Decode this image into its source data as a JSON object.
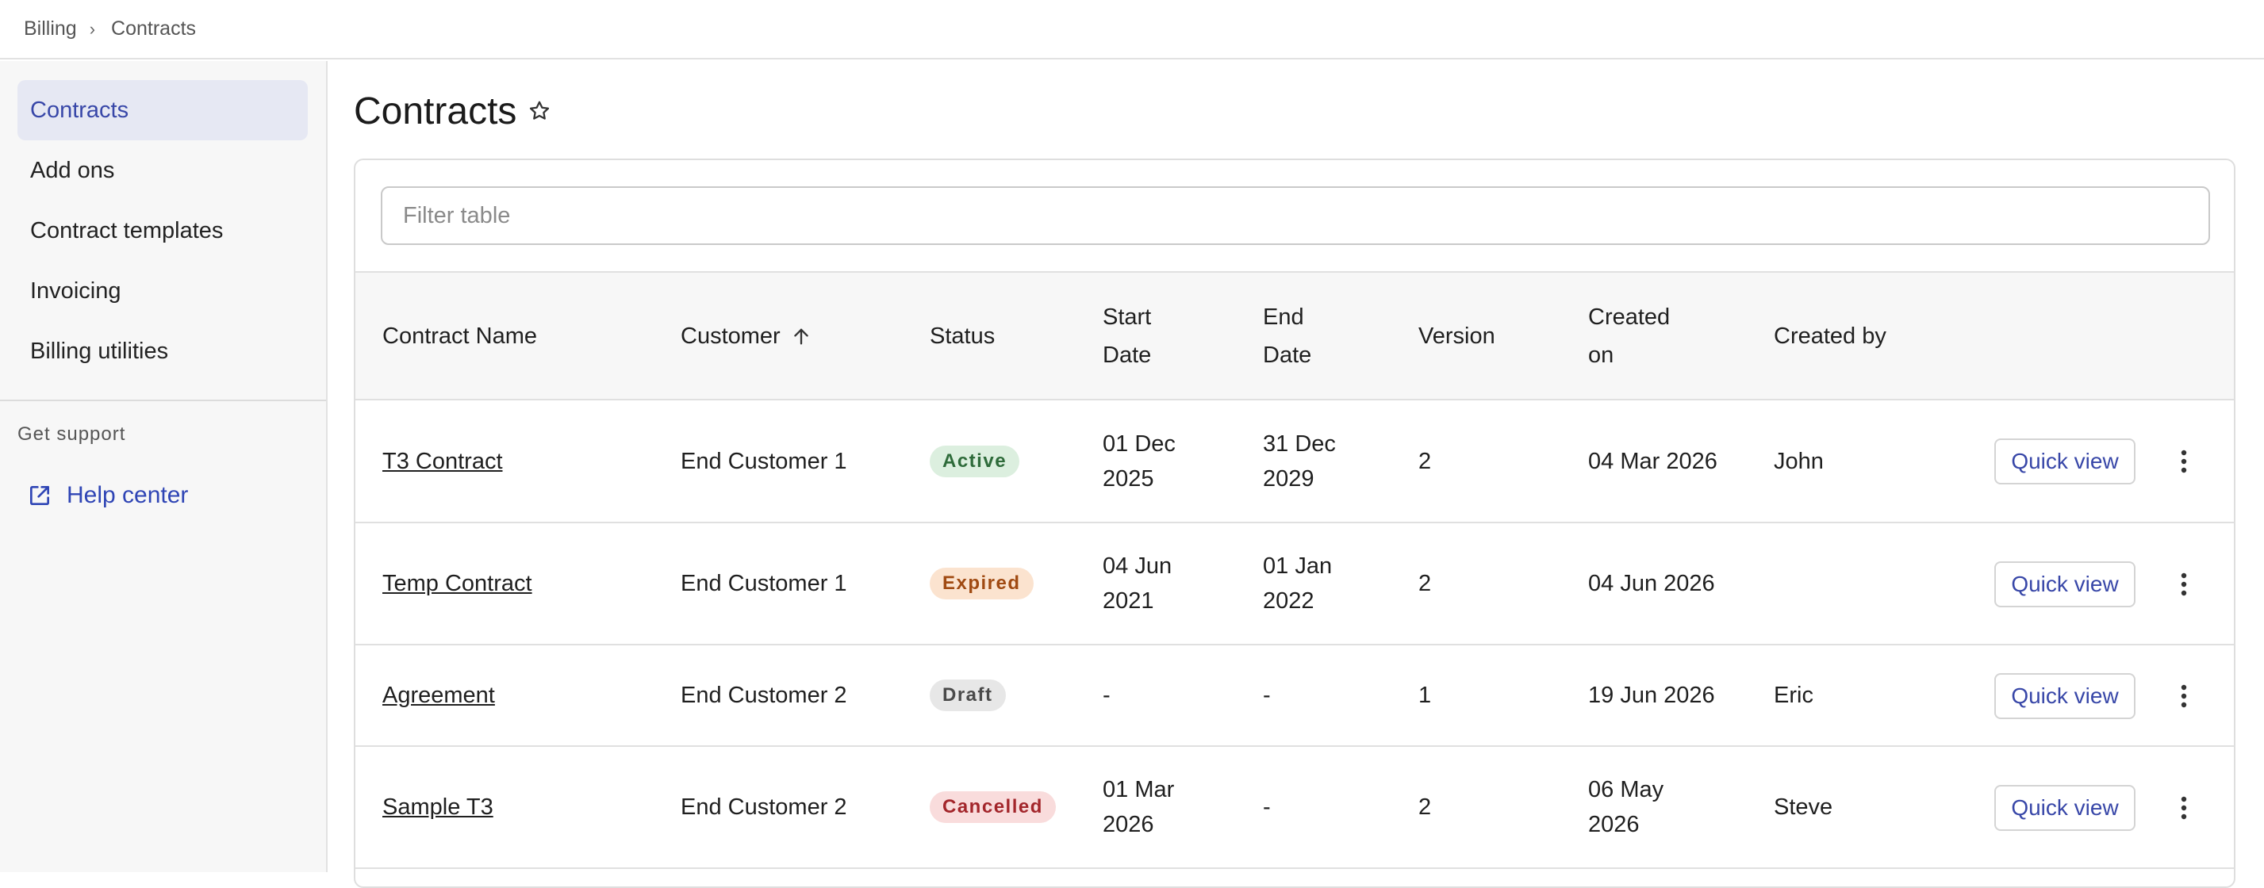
{
  "breadcrumb": {
    "root": "Billing",
    "separator": "›",
    "current": "Contracts"
  },
  "sidebar": {
    "items": [
      {
        "label": "Contracts",
        "active": true
      },
      {
        "label": "Add ons",
        "active": false
      },
      {
        "label": "Contract templates",
        "active": false
      },
      {
        "label": "Invoicing",
        "active": false
      },
      {
        "label": "Billing utilities",
        "active": false
      }
    ],
    "support_label": "Get support",
    "help_link": "Help center"
  },
  "page": {
    "title": "Contracts",
    "star_icon": "star-outline-icon"
  },
  "filter": {
    "placeholder": "Filter table",
    "value": ""
  },
  "table": {
    "columns": {
      "contract_name": "Contract Name",
      "customer": "Customer",
      "status": "Status",
      "start_date_1": "Start",
      "start_date_2": "Date",
      "end_date_1": "End",
      "end_date_2": "Date",
      "version": "Version",
      "created_on_1": "Created",
      "created_on_2": "on",
      "created_by": "Created by"
    },
    "sort_icon": "arrow-up-icon",
    "quick_view_label": "Quick view",
    "rows": [
      {
        "name": "T3 Contract",
        "customer": "End Customer 1",
        "status": "Active",
        "start_1": "01 Dec",
        "start_2": "2025",
        "end_1": "31 Dec",
        "end_2": "2029",
        "version": "2",
        "created_on_1": "04 Mar 2026",
        "created_on_2": "",
        "created_by": "John"
      },
      {
        "name": "Temp Contract",
        "customer": "End Customer 1",
        "status": "Expired",
        "start_1": "04 Jun",
        "start_2": "2021",
        "end_1": "01 Jan",
        "end_2": "2022",
        "version": "2",
        "created_on_1": "04 Jun 2026",
        "created_on_2": "",
        "created_by": ""
      },
      {
        "name": "Agreement",
        "customer": "End Customer 2",
        "status": "Draft",
        "start_1": "-",
        "start_2": "",
        "end_1": "-",
        "end_2": "",
        "version": "1",
        "created_on_1": "19 Jun 2026",
        "created_on_2": "",
        "created_by": "Eric"
      },
      {
        "name": "Sample T3",
        "customer": "End Customer 2",
        "status": "Cancelled",
        "start_1": "01 Mar",
        "start_2": "2026",
        "end_1": "-",
        "end_2": "",
        "version": "2",
        "created_on_1": "06 May",
        "created_on_2": "2026",
        "created_by": "Steve"
      }
    ]
  },
  "status_colors": {
    "Active": {
      "bg": "#dcefdf",
      "fg": "#2e6b3a"
    },
    "Expired": {
      "bg": "#fbe3cf",
      "fg": "#a04a12"
    },
    "Draft": {
      "bg": "#e7e7e7",
      "fg": "#4a4a4a"
    },
    "Cancelled": {
      "bg": "#f9dcdc",
      "fg": "#a3262b"
    }
  },
  "colors": {
    "accent": "#3847a8",
    "active_nav_bg": "#e6e8f3"
  }
}
